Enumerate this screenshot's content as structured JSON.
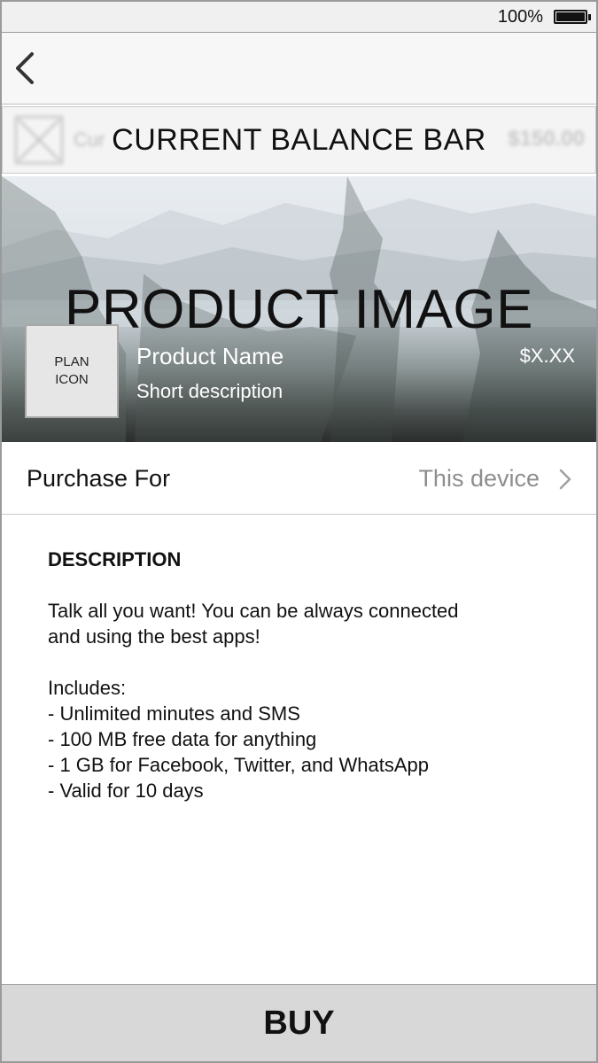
{
  "status_bar": {
    "battery_percent": "100%",
    "battery_level": 1.0
  },
  "nav": {
    "back_icon": "chevron-left-icon"
  },
  "balance_bar": {
    "label_behind": "Cur",
    "amount": "$150.00",
    "overlay_label": "CURRENT BALANCE BAR",
    "thumbnail_icon": "image-placeholder-icon"
  },
  "product": {
    "image_label": "PRODUCT IMAGE",
    "plan_icon_label_1": "PLAN",
    "plan_icon_label_2": "ICON",
    "name": "Product Name",
    "short_description": "Short description",
    "price": "$X.XX"
  },
  "purchase_for": {
    "label": "Purchase For",
    "value": "This device",
    "chevron_icon": "chevron-right-icon"
  },
  "description": {
    "heading": "DESCRIPTION",
    "paragraph_line_1": "Talk all you want! You can be always connected",
    "paragraph_line_2": "and using the best apps!",
    "includes_label": "Includes:",
    "items": [
      "- Unlimited minutes and SMS",
      "- 100 MB free data for anything",
      "- 1 GB for Facebook, Twitter, and WhatsApp",
      "- Valid for 10 days"
    ]
  },
  "buy": {
    "label": "BUY"
  },
  "colors": {
    "status_bar_bg": "#f0f0f0",
    "nav_bg": "#f7f7f7",
    "buy_bg": "#d8d8d8",
    "secondary_text": "#8e8e8e"
  }
}
